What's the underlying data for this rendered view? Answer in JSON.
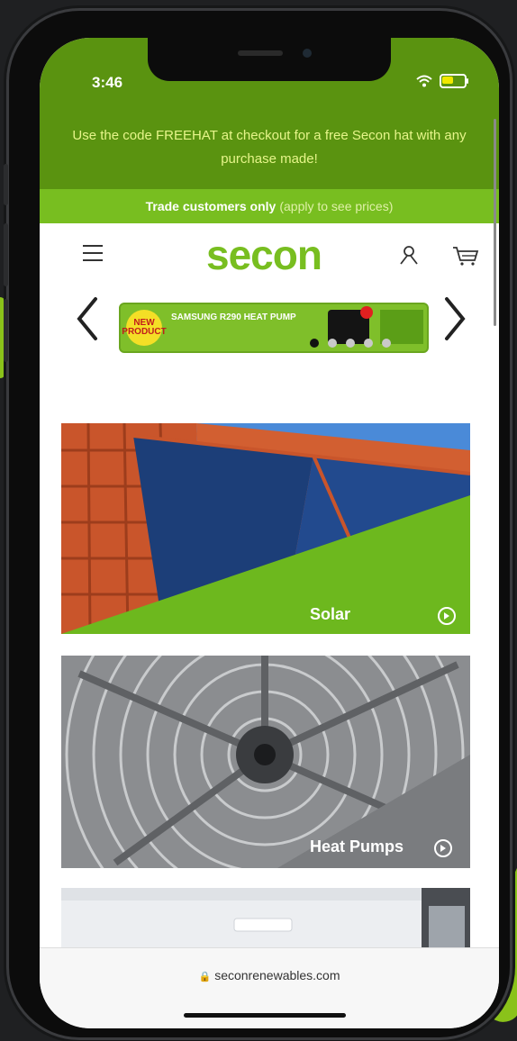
{
  "status": {
    "time": "3:46",
    "battery_color": "#f1e800"
  },
  "promo": {
    "text": "Use the code FREEHAT at checkout for a free Secon hat with any purchase made!",
    "bg_color": "#5a9310"
  },
  "trade": {
    "strong": "Trade customers only",
    "note": "(apply to see prices)"
  },
  "header": {
    "logo": "secon",
    "brand_color": "#78be20"
  },
  "carousel": {
    "badge": "NEW PRODUCT",
    "banner_text": "SAMSUNG R290 HEAT PUMP",
    "dot_count": 5,
    "active_dot": 1
  },
  "categories": [
    {
      "label": "Solar"
    },
    {
      "label": "Heat Pumps"
    }
  ],
  "browser": {
    "url": "seconrenewables.com"
  },
  "icons": [
    "wifi-icon",
    "battery-icon",
    "menu-icon",
    "user-icon",
    "cart-icon",
    "chevron-left-icon",
    "chevron-right-icon",
    "arrow-circle-icon",
    "lock-icon"
  ]
}
